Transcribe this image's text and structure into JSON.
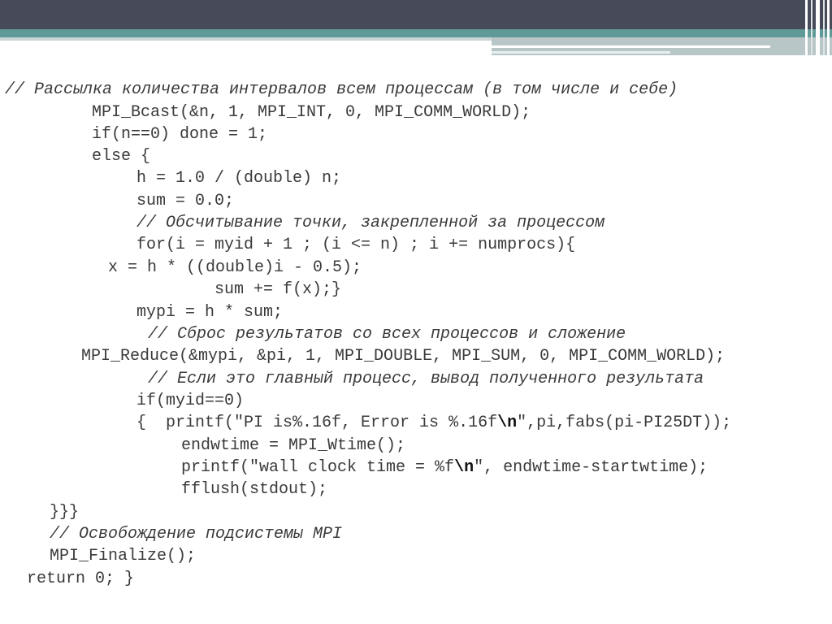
{
  "code": {
    "l01": "// Рассылка количества интервалов всем процессам (в том числе и себе)",
    "l02": "MPI_Bcast(&n, 1, MPI_INT, 0, MPI_COMM_WORLD);",
    "l03": "if(n==0) done = 1;",
    "l04": "else {",
    "l05": "h = 1.0 / (double) n;",
    "l06": "sum = 0.0;",
    "l07": "// Обсчитывание точки, закрепленной за процессом",
    "l08": "for(i = myid + 1 ; (i <= n) ; i += numprocs){",
    "l09": "x = h * ((double)i - 0.5);",
    "l10": "sum += f(x);}",
    "l11": "mypi = h * sum;",
    "l12": "// Сброс результатов со всех процессов и сложение",
    "l13": "MPI_Reduce(&mypi, &pi, 1, MPI_DOUBLE, MPI_SUM, 0, MPI_COMM_WORLD);",
    "l14": "// Если это главный процесс, вывод полученного результата",
    "l15": "if(myid==0)",
    "l16a": "{  printf(\"PI is%.16f, Error is %.16f",
    "l16b": "\\n",
    "l16c": "\",pi,fabs(pi-PI25DT));",
    "l17": "endwtime = MPI_Wtime();",
    "l18a": "printf(\"wall clock time = %f",
    "l18b": "\\n",
    "l18c": "\", endwtime-startwtime);",
    "l19": "fflush(stdout);",
    "l20": "}}}",
    "l21": "// Освобождение подсистемы MPI",
    "l22": "MPI_Finalize();",
    "l23": "return 0; }"
  }
}
